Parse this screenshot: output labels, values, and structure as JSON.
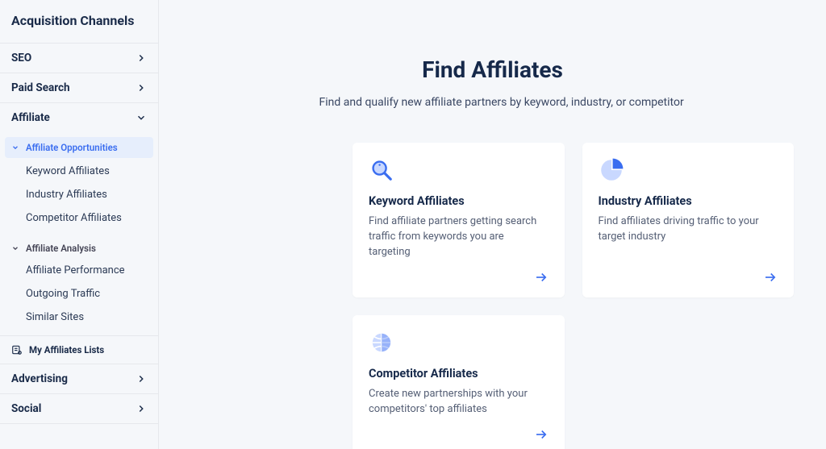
{
  "sidebar": {
    "title": "Acquisition Channels",
    "items": [
      {
        "label": "SEO"
      },
      {
        "label": "Paid Search"
      },
      {
        "label": "Affiliate"
      },
      {
        "label": "Advertising"
      },
      {
        "label": "Social"
      }
    ],
    "affiliate": {
      "opportunities": {
        "header": "Affiliate Opportunities",
        "links": [
          {
            "label": "Keyword Affiliates"
          },
          {
            "label": "Industry Affiliates"
          },
          {
            "label": "Competitor Affiliates"
          }
        ]
      },
      "analysis": {
        "header": "Affiliate Analysis",
        "links": [
          {
            "label": "Affiliate Performance"
          },
          {
            "label": "Outgoing Traffic"
          },
          {
            "label": "Similar Sites"
          }
        ]
      },
      "lists_label": "My Affiliates Lists"
    }
  },
  "hero": {
    "title": "Find Affiliates",
    "subtitle": "Find and qualify new affiliate partners by keyword, industry, or competitor"
  },
  "cards": [
    {
      "title": "Keyword Affiliates",
      "desc": "Find affiliate partners getting search traffic from keywords you are targeting"
    },
    {
      "title": "Industry Affiliates",
      "desc": "Find affiliates driving traffic to your target industry"
    },
    {
      "title": "Competitor Affiliates",
      "desc": "Create new partnerships with your competitors' top affiliates"
    }
  ]
}
